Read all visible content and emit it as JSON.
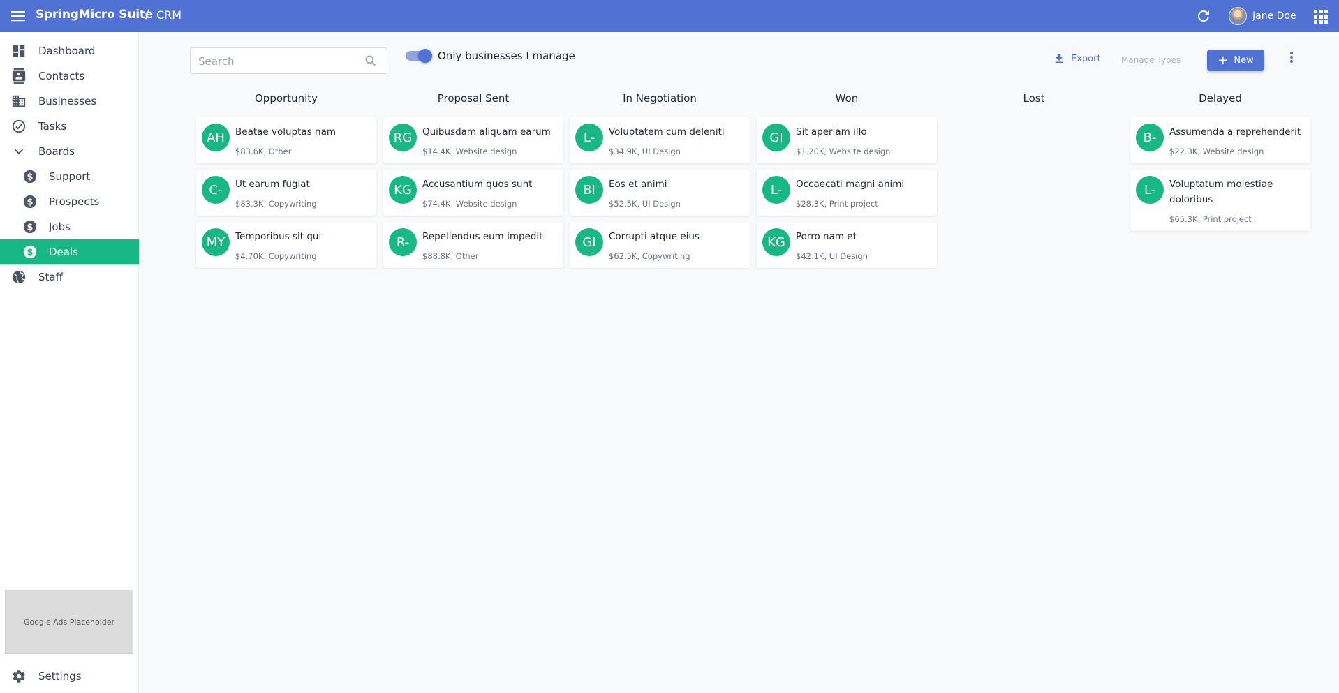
{
  "topbar": {
    "brand": "SpringMicro Suite",
    "separator": "/",
    "section": "CRM",
    "user_name": "Jane Doe",
    "color": "#4f72d4"
  },
  "sidebar": {
    "items": [
      {
        "label": "Dashboard",
        "icon": "dashboard-icon"
      },
      {
        "label": "Contacts",
        "icon": "contacts-icon"
      },
      {
        "label": "Businesses",
        "icon": "building-icon"
      },
      {
        "label": "Tasks",
        "icon": "check-circle-icon"
      },
      {
        "label": "Boards",
        "icon": "chevron-down-icon"
      },
      {
        "label": "Support",
        "icon": "dollar-icon"
      },
      {
        "label": "Prospects",
        "icon": "dollar-icon"
      },
      {
        "label": "Jobs",
        "icon": "dollar-icon"
      },
      {
        "label": "Deals",
        "icon": "dollar-icon",
        "active": true
      },
      {
        "label": "Staff",
        "icon": "globe-icon"
      }
    ],
    "ads_label": "Google Ads Placeholder",
    "settings_label": "Settings",
    "active_color": "#17b883"
  },
  "toolbar": {
    "search_placeholder": "Search",
    "toggle_label": "Only businesses I manage",
    "toggle_on": true,
    "export_label": "Export",
    "manage_types_label": "Manage Types",
    "new_label": "New"
  },
  "board": {
    "columns": [
      {
        "title": "Opportunity",
        "cards": [
          {
            "initials": "AH",
            "name": "Beatae voluptas nam",
            "meta": "$83.6K, Other"
          },
          {
            "initials": "C-",
            "name": "Ut earum fugiat",
            "meta": "$83.3K, Copywriting"
          },
          {
            "initials": "MY",
            "name": "Temporibus sit qui",
            "meta": "$4.70K, Copywriting"
          }
        ]
      },
      {
        "title": "Proposal Sent",
        "cards": [
          {
            "initials": "RG",
            "name": "Quibusdam aliquam earum",
            "meta": "$14.4K, Website design"
          },
          {
            "initials": "KG",
            "name": "Accusantium quos sunt",
            "meta": "$74.4K, Website design"
          },
          {
            "initials": "R-",
            "name": "Repellendus eum impedit",
            "meta": "$88.8K, Other"
          }
        ]
      },
      {
        "title": "In Negotiation",
        "cards": [
          {
            "initials": "L-",
            "name": "Voluptatem cum deleniti",
            "meta": "$34.9K, UI Design"
          },
          {
            "initials": "BI",
            "name": "Eos et animi",
            "meta": "$52.5K, UI Design"
          },
          {
            "initials": "GI",
            "name": "Corrupti atque eius",
            "meta": "$62.5K, Copywriting"
          }
        ]
      },
      {
        "title": "Won",
        "cards": [
          {
            "initials": "GI",
            "name": "Sit aperiam illo",
            "meta": "$1.20K, Website design"
          },
          {
            "initials": "L-",
            "name": "Occaecati magni animi",
            "meta": "$28.3K, Print project"
          },
          {
            "initials": "KG",
            "name": "Porro nam et",
            "meta": "$42.1K, UI Design"
          }
        ]
      },
      {
        "title": "Lost",
        "cards": []
      },
      {
        "title": "Delayed",
        "cards": [
          {
            "initials": "B-",
            "name": "Assumenda a reprehenderit",
            "meta": "$22.3K, Website design"
          },
          {
            "initials": "L-",
            "name": "Voluptatum molestiae doloribus",
            "meta": "$65.3K, Print project"
          }
        ]
      }
    ],
    "avatar_color": "#17b883"
  }
}
